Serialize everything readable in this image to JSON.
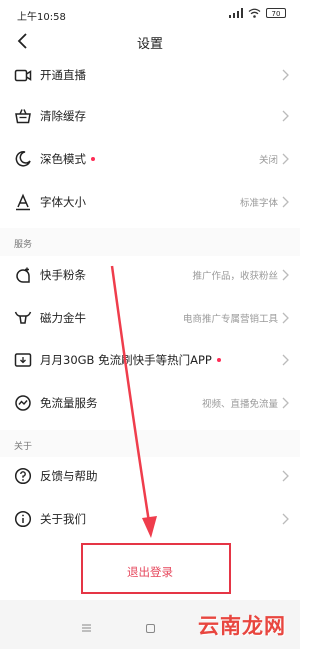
{
  "status_bar": {
    "time": "上午10:58",
    "battery": "70"
  },
  "header": {
    "title": "设置"
  },
  "rows_top": [
    {
      "label": "开通直播",
      "value": "",
      "dot": false,
      "icon": "camera-icon"
    },
    {
      "label": "清除缓存",
      "value": "",
      "dot": false,
      "icon": "basket-icon"
    },
    {
      "label": "深色模式",
      "value": "关闭",
      "dot": true,
      "icon": "moon-icon"
    },
    {
      "label": "字体大小",
      "value": "标准字体",
      "dot": false,
      "icon": "font-size-icon"
    }
  ],
  "section_service": "服务",
  "rows_service": [
    {
      "label": "快手粉条",
      "value": "推广作品，收获粉丝",
      "dot": false,
      "icon": "promo-icon"
    },
    {
      "label": "磁力金牛",
      "value": "电商推广专属营销工具",
      "dot": false,
      "icon": "bull-icon"
    },
    {
      "label": "月月30GB 免流刷快手等热门APP",
      "value": "",
      "dot": true,
      "icon": "data-card-icon"
    },
    {
      "label": "免流量服务",
      "value": "视频、直播免流量",
      "dot": false,
      "icon": "traffic-icon"
    }
  ],
  "section_about": "关于",
  "rows_about": [
    {
      "label": "反馈与帮助",
      "value": "",
      "dot": false,
      "icon": "help-icon"
    },
    {
      "label": "关于我们",
      "value": "",
      "dot": false,
      "icon": "info-icon"
    }
  ],
  "logout_label": "退出登录",
  "watermark": "云南龙网",
  "colors": {
    "accent": "#fe2c55",
    "annotation": "#e53545",
    "logout": "#e6495e"
  }
}
